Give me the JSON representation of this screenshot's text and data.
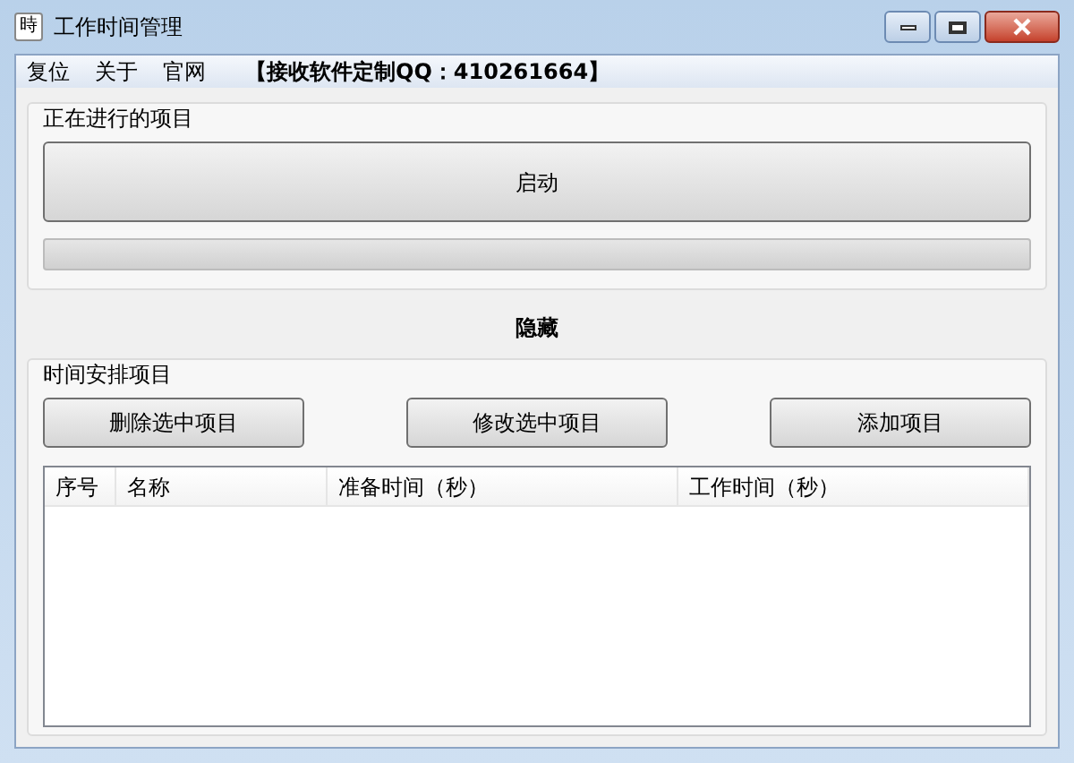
{
  "window": {
    "icon_text": "時",
    "title": "工作时间管理"
  },
  "menu": [
    "复位",
    "关于",
    "官网"
  ],
  "menu_note": "【接收软件定制QQ：410261664】",
  "running_group": {
    "title": "正在进行的项目",
    "start_button": "启动",
    "progress": {
      "level": 0
    }
  },
  "hide_label": "隐藏",
  "schedule_group": {
    "title": "时间安排项目",
    "buttons": [
      "删除选中项目",
      "修改选中项目",
      "添加项目"
    ],
    "table": {
      "columns": [
        "序号",
        "名称",
        "准备时间（秒）",
        "工作时间（秒）"
      ]
    }
  }
}
